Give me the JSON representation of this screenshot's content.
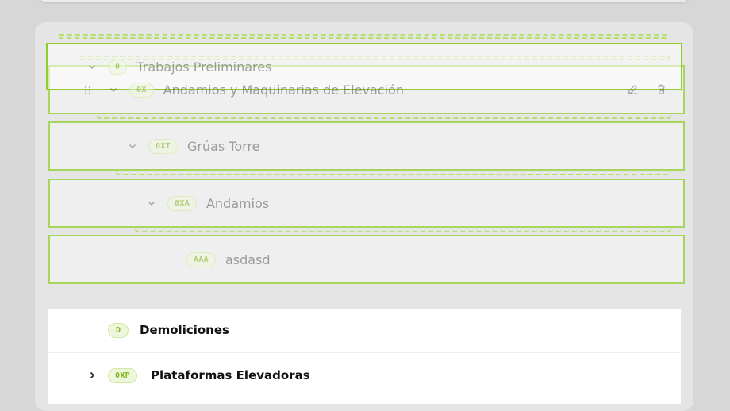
{
  "tree": {
    "drag_preview": {
      "code": "0",
      "name": "Trabajos Preliminares"
    },
    "nodes": [
      {
        "code": "0X",
        "name": "Andamios y Maquinarias de Elevación",
        "expanded": true
      },
      {
        "code": "0XT",
        "name": "Grúas Torre",
        "expanded": true
      },
      {
        "code": "0XA",
        "name": "Andamios",
        "expanded": true
      },
      {
        "code": "AAA",
        "name": "asdasd",
        "expanded": false
      }
    ],
    "actions": {
      "edit_icon": "edit-icon",
      "delete_icon": "trash-icon"
    }
  },
  "list": {
    "items": [
      {
        "code": "D",
        "name": "Demoliciones",
        "expandable": false
      },
      {
        "code": "0XP",
        "name": "Plataformas Elevadoras",
        "expandable": true
      }
    ]
  },
  "colors": {
    "accent": "#a7d65c",
    "badge_text": "#7fb61a",
    "badge_bg": "#eef7dc"
  }
}
